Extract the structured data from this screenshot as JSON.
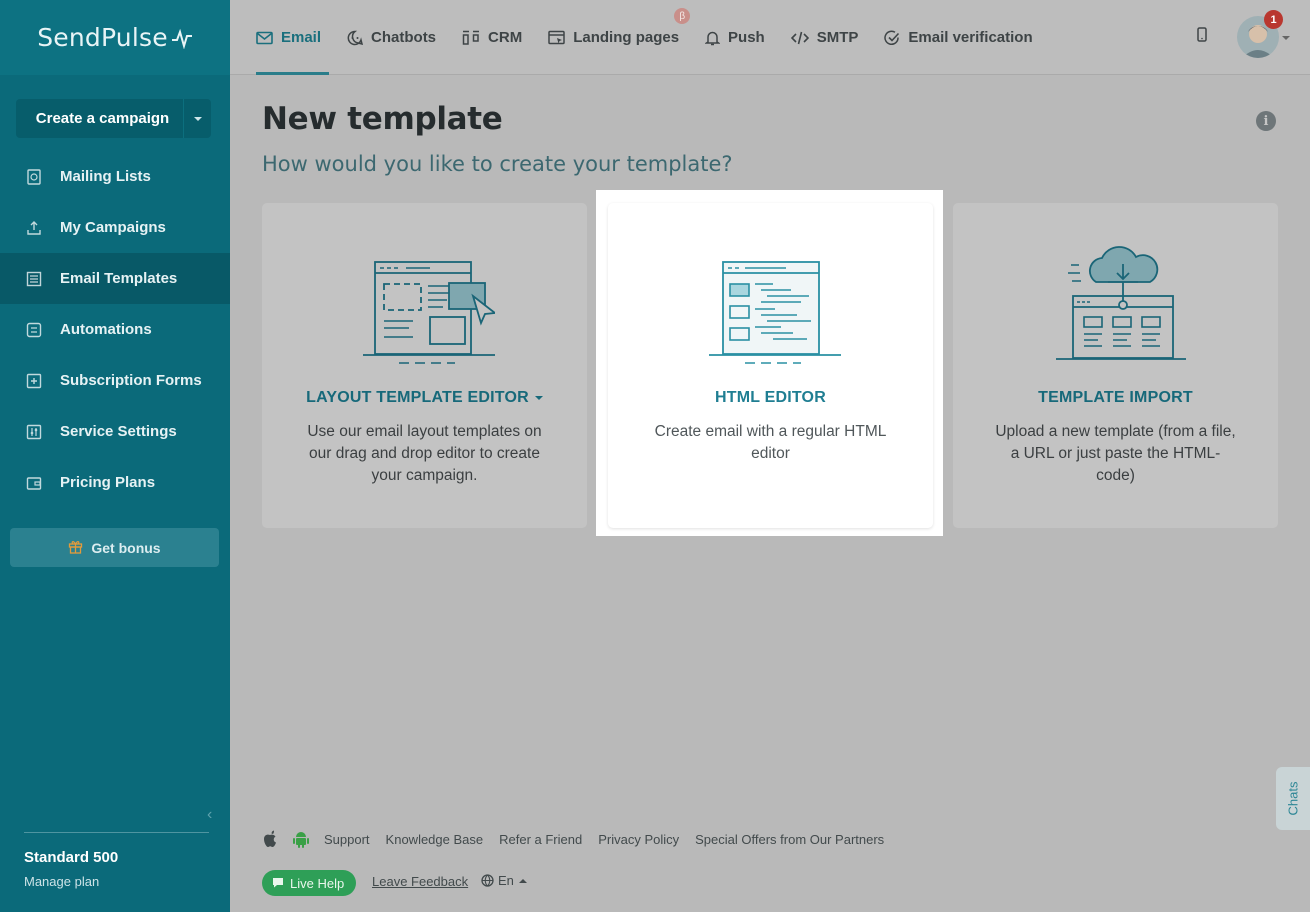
{
  "app": {
    "name": "SendPulse"
  },
  "sidebar": {
    "create_label": "Create a campaign",
    "items": [
      {
        "label": "Mailing Lists",
        "icon": "mailing-lists-icon"
      },
      {
        "label": "My Campaigns",
        "icon": "campaigns-icon"
      },
      {
        "label": "Email Templates",
        "icon": "templates-icon",
        "active": true
      },
      {
        "label": "Automations",
        "icon": "automations-icon"
      },
      {
        "label": "Subscription Forms",
        "icon": "forms-icon"
      },
      {
        "label": "Service Settings",
        "icon": "settings-icon"
      },
      {
        "label": "Pricing Plans",
        "icon": "wallet-icon"
      }
    ],
    "bonus_label": "Get bonus",
    "plan_name": "Standard 500",
    "plan_manage": "Manage plan"
  },
  "topnav": {
    "items": [
      {
        "label": "Email",
        "icon": "email-icon",
        "active": true
      },
      {
        "label": "Chatbots",
        "icon": "chatbots-icon"
      },
      {
        "label": "CRM",
        "icon": "crm-icon"
      },
      {
        "label": "Landing pages",
        "icon": "landing-icon",
        "badge": "β"
      },
      {
        "label": "Push",
        "icon": "bell-icon"
      },
      {
        "label": "SMTP",
        "icon": "code-icon"
      },
      {
        "label": "Email verification",
        "icon": "check-circle-icon"
      }
    ],
    "notification_count": "1"
  },
  "main": {
    "title": "New template",
    "subtitle": "How would you like to create your template?",
    "cards": [
      {
        "title": "LAYOUT TEMPLATE EDITOR",
        "desc": "Use our email layout templates on our drag and drop editor to create your campaign."
      },
      {
        "title": "HTML EDITOR",
        "desc": "Create email with a regular HTML editor"
      },
      {
        "title": "TEMPLATE IMPORT",
        "desc": "Upload a new template (from a file, a URL or just paste the HTML-code)"
      }
    ]
  },
  "footer": {
    "links": [
      "Support",
      "Knowledge Base",
      "Refer a Friend",
      "Privacy Policy",
      "Special Offers from Our Partners"
    ],
    "live_help": "Live Help",
    "feedback": "Leave Feedback",
    "lang": "En",
    "chats": "Chats"
  },
  "colors": {
    "sidebar": "#0b6a7a",
    "accent": "#17697a",
    "overlay": "#bdbdbd",
    "live_help": "#2e9f57",
    "badge": "#b9372f"
  }
}
